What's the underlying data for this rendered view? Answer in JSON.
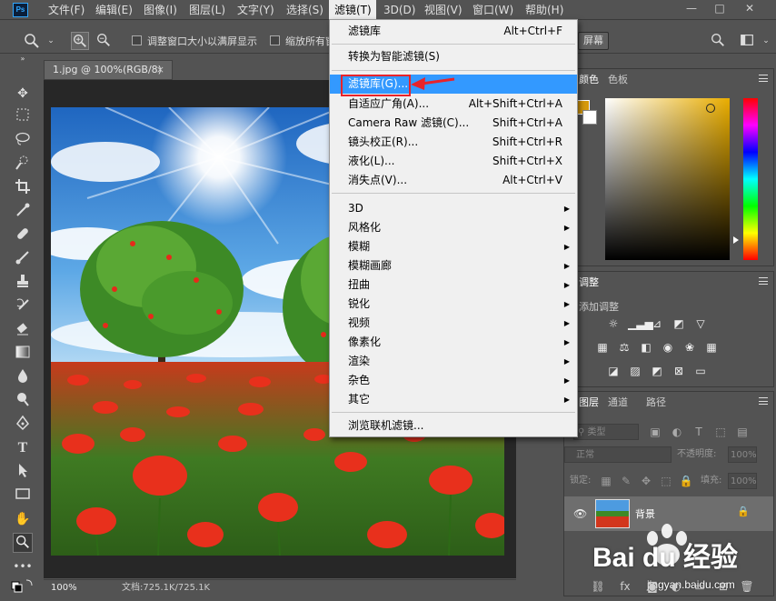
{
  "app": {
    "logo_text": "Ps"
  },
  "menubar": {
    "items": [
      "文件(F)",
      "编辑(E)",
      "图像(I)",
      "图层(L)",
      "文字(Y)",
      "选择(S)",
      "滤镜(T)",
      "3D(D)",
      "视图(V)",
      "窗口(W)",
      "帮助(H)"
    ],
    "active": "滤镜(T)",
    "window_controls": [
      "—",
      "□",
      "✕"
    ]
  },
  "options_bar": {
    "checkbox1_label": "调整窗口大小以满屏显示",
    "checkbox2_label": "缩放所有窗",
    "fill_screen_button": "屏幕"
  },
  "document": {
    "tab_title": "1.jpg @ 100%(RGB/8)",
    "tab_close": "×",
    "zoom": "100%",
    "doc_size": "文档:725.1K/725.1K"
  },
  "filter_menu": {
    "items": [
      {
        "label": "滤镜库",
        "shortcut": "Alt+Ctrl+F"
      },
      {
        "label": "转换为智能滤镜(S)",
        "shortcut": ""
      },
      {
        "label": "滤镜库(G)...",
        "shortcut": "",
        "highlighted": true
      },
      {
        "label": "自适应广角(A)...",
        "shortcut": "Alt+Shift+Ctrl+A"
      },
      {
        "label": "Camera Raw 滤镜(C)...",
        "shortcut": "Shift+Ctrl+A"
      },
      {
        "label": "镜头校正(R)...",
        "shortcut": "Shift+Ctrl+R"
      },
      {
        "label": "液化(L)...",
        "shortcut": "Shift+Ctrl+X"
      },
      {
        "label": "消失点(V)...",
        "shortcut": "Alt+Ctrl+V"
      },
      {
        "label": "3D",
        "submenu": true
      },
      {
        "label": "风格化",
        "submenu": true
      },
      {
        "label": "模糊",
        "submenu": true
      },
      {
        "label": "模糊画廊",
        "submenu": true
      },
      {
        "label": "扭曲",
        "submenu": true
      },
      {
        "label": "锐化",
        "submenu": true
      },
      {
        "label": "视频",
        "submenu": true
      },
      {
        "label": "像素化",
        "submenu": true
      },
      {
        "label": "渲染",
        "submenu": true
      },
      {
        "label": "杂色",
        "submenu": true
      },
      {
        "label": "其它",
        "submenu": true
      },
      {
        "label": "浏览联机滤镜...",
        "shortcut": ""
      }
    ]
  },
  "color_panel": {
    "tab1": "颜色",
    "tab2": "色板"
  },
  "adjust_panel": {
    "tab": "调整",
    "add_label": "添加调整"
  },
  "layers_panel": {
    "tabs": [
      "图层",
      "通道",
      "路径"
    ],
    "kind_label": "类型",
    "blend_mode": "正常",
    "opacity_label": "不透明度:",
    "opacity_value": "100%",
    "lock_label": "锁定:",
    "fill_label": "填充:",
    "fill_value": "100%",
    "layer_name": "背景"
  },
  "watermark": {
    "brand": "Bai du 经验",
    "url": "jingyan.baidu.com"
  },
  "colors": {
    "accent_highlight": "#3399ff",
    "annotation_red": "#e8232a",
    "foreground_swatch": "#d79a0b"
  }
}
